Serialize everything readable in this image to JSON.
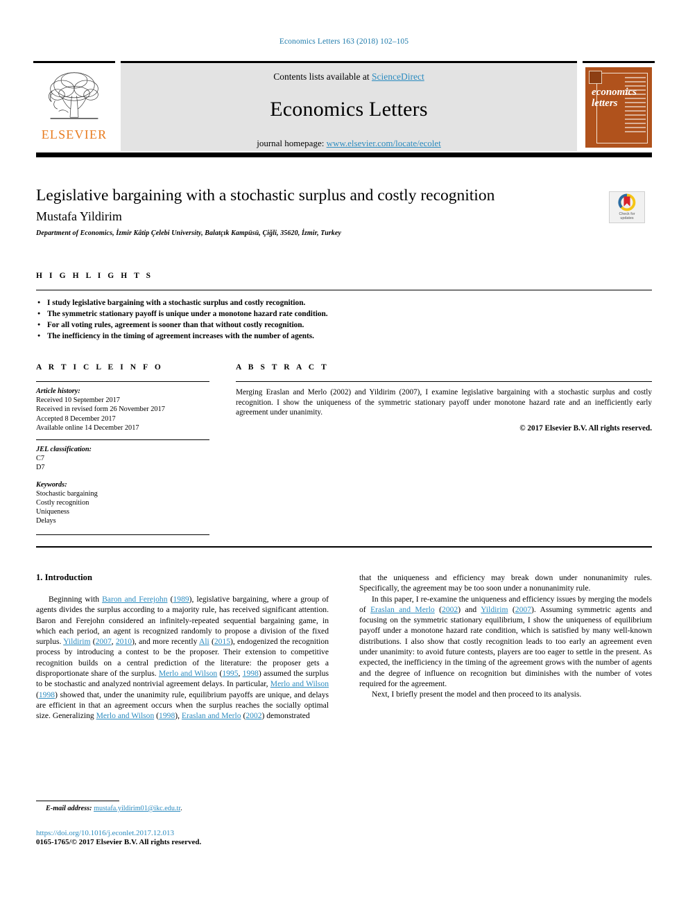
{
  "running_head": "Economics Letters 163 (2018) 102–105",
  "masthead": {
    "publisher_name": "ELSEVIER",
    "contents_prefix": "Contents lists available at ",
    "contents_link": "ScienceDirect",
    "journal_title": "Economics Letters",
    "homepage_prefix": "journal homepage: ",
    "homepage_link": "www.elsevier.com/locate/ecolet",
    "cover_line1": "economics",
    "cover_line2": "letters"
  },
  "article": {
    "title": "Legislative bargaining with a stochastic surplus and costly recognition",
    "author": "Mustafa Yildirim",
    "affiliation": "Department of Economics, İzmir Kâtip Çelebi University, Balatçık Kampüsü, Çiğli, 35620, İzmir, Turkey",
    "crossmark_label_line1": "Check for",
    "crossmark_label_line2": "updates"
  },
  "highlights": {
    "heading": "H I G H L I G H T S",
    "items": [
      "I study legislative bargaining with a stochastic surplus and costly recognition.",
      "The symmetric stationary payoff is unique under a monotone hazard rate condition.",
      "For all voting rules, agreement is sooner than that without costly recognition.",
      "The inefficiency in the timing of agreement increases with the number of agents."
    ]
  },
  "article_info": {
    "heading": "A R T I C L E   I N F O",
    "history_label": "Article history:",
    "history": [
      "Received 10 September 2017",
      "Received in revised form 26 November 2017",
      "Accepted 8 December 2017",
      "Available online 14 December 2017"
    ],
    "jel_label": "JEL classification:",
    "jel": [
      "C7",
      "D7"
    ],
    "keywords_label": "Keywords:",
    "keywords": [
      "Stochastic bargaining",
      "Costly recognition",
      "Uniqueness",
      "Delays"
    ]
  },
  "abstract": {
    "heading": "A B S T R A C T",
    "text": "Merging Eraslan and Merlo (2002) and Yildirim (2007), I examine legislative bargaining with a stochastic surplus and costly recognition. I show the uniqueness of the symmetric stationary payoff under monotone hazard rate and an inefficiently early agreement under unanimity.",
    "copyright": "© 2017 Elsevier B.V. All rights reserved."
  },
  "body": {
    "section_title": "1. Introduction",
    "left_paragraph_1": {
      "t1": "Beginning with ",
      "l1": "Baron and Ferejohn",
      "t2": " (",
      "l2": "1989",
      "t3": "), legislative bargaining, where a group of agents divides the surplus according to a majority rule, has received significant attention. Baron and Ferejohn considered an infinitely-repeated sequential bargaining game, in which each period, an agent is recognized randomly to propose a division of the fixed surplus. ",
      "l3": "Yildirim",
      "t4": " (",
      "l4": "2007",
      "t5": ", ",
      "l5": "2010",
      "t6": "), and more recently ",
      "l6": "Ali",
      "t7": " (",
      "l7": "2015",
      "t8": "), endogenized the recognition process by introducing a contest to be the proposer. Their extension to competitive recognition builds on a central prediction of the literature: the proposer gets a disproportionate share of the surplus. ",
      "l8": "Merlo and Wilson",
      "t9": " (",
      "l9": "1995",
      "t10": ", ",
      "l10": "1998",
      "t11": ") assumed the surplus to be stochastic and analyzed nontrivial agreement delays. In particular, ",
      "l11": "Merlo and Wilson",
      "t12": " (",
      "l12": "1998",
      "t13": ") showed that, under the unanimity rule, equilibrium payoffs are unique, and delays are efficient in that an agreement occurs when the surplus reaches the socially optimal size. Generalizing ",
      "l13": "Merlo and Wilson",
      "t14": " (",
      "l14": "1998",
      "t15": "), ",
      "l15": "Eraslan and Merlo",
      "t16": " (",
      "l16": "2002",
      "t17": ") demonstrated"
    },
    "right_paragraph_1": "that the uniqueness and efficiency may break down under nonunanimity rules. Specifically, the agreement may be too soon under a nonunanimity rule.",
    "right_paragraph_2": {
      "t1": "In this paper, I re-examine the uniqueness and efficiency issues by merging the models of ",
      "l1": "Eraslan and Merlo",
      "t2": " (",
      "l2": "2002",
      "t3": ") and ",
      "l3": "Yildirim",
      "t4": " (",
      "l4": "2007",
      "t5": "). Assuming symmetric agents and focusing on the symmetric stationary equilibrium, I show the uniqueness of equilibrium payoff under a monotone hazard rate condition, which is satisfied by many well-known distributions. I also show that costly recognition leads to too early an agreement even under unanimity: to avoid future contests, players are too eager to settle in the present. As expected, the inefficiency in the timing of the agreement grows with the number of agents and the degree of influence on recognition but diminishes with the number of votes required for the agreement."
    },
    "right_paragraph_3": "Next, I briefly present the model and then proceed to its analysis."
  },
  "footer": {
    "email_label": "E-mail address:",
    "email": "mustafa.yildirim01@ikc.edu.tr",
    "email_suffix": ".",
    "doi": "https://doi.org/10.1016/j.econlet.2017.12.013",
    "issn_line": "0165-1765/© 2017 Elsevier B.V. All rights reserved."
  },
  "colors": {
    "link": "#2b8bbf",
    "running_head": "#1f7bab",
    "elsevier_orange": "#E87B1E",
    "cover_bg": "#B0521C",
    "band_bg": "#e3e3e3"
  }
}
